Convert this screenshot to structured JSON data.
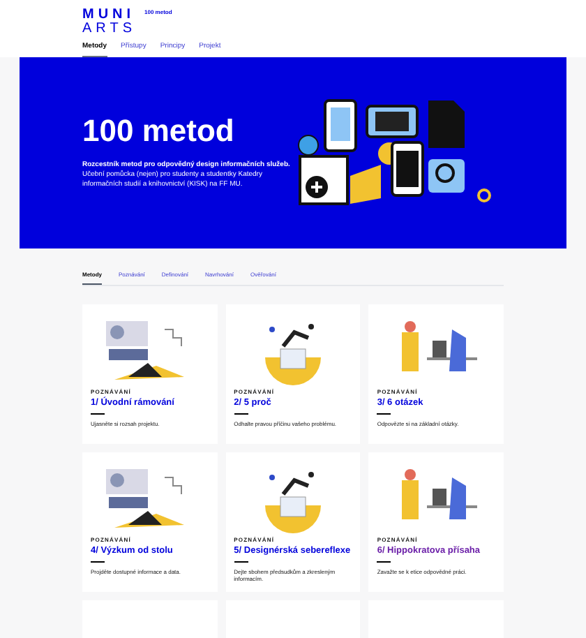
{
  "header": {
    "logo_top": "MUNI",
    "logo_bottom": "ARTS",
    "site_name": "100 metod"
  },
  "nav": [
    {
      "label": "Metody",
      "selected": true
    },
    {
      "label": "Přístupy",
      "selected": false
    },
    {
      "label": "Principy",
      "selected": false
    },
    {
      "label": "Projekt",
      "selected": false
    }
  ],
  "hero": {
    "title": "100 metod",
    "description": "**Rozcestník metod pro odpovědný design informačních služeb.** Učební pomůcka (nejen) pro studenty a studentky Katedry informačních studií a knihovnictví (KISK) na FF MU."
  },
  "filter_tabs": [
    {
      "label": "Metody",
      "selected": true
    },
    {
      "label": "Poznávání",
      "selected": false
    },
    {
      "label": "Definování",
      "selected": false
    },
    {
      "label": "Navrhování",
      "selected": false
    },
    {
      "label": "Ověřování",
      "selected": false
    }
  ],
  "cards": [
    {
      "category": "POZNÁVÁNÍ",
      "title": "1/ Úvodní rámování",
      "description": "Ujasněte si rozsah projektu.",
      "visited": false
    },
    {
      "category": "POZNÁVÁNÍ",
      "title": "2/ 5 proč",
      "description": "Odhalte pravou příčinu vašeho problému.",
      "visited": false
    },
    {
      "category": "POZNÁVÁNÍ",
      "title": "3/ 6 otázek",
      "description": "Odpovězte si na základní otázky.",
      "visited": false
    },
    {
      "category": "POZNÁVÁNÍ",
      "title": "4/ Výzkum od stolu",
      "description": "Projděte dostupné informace a data.",
      "visited": false
    },
    {
      "category": "POZNÁVÁNÍ",
      "title": "5/ Designérská sebereflexe",
      "description": "Dejte sbohem předsudkům a zkresleným informacím.",
      "visited": false
    },
    {
      "category": "POZNÁVÁNÍ",
      "title": "6/ Hippokratova přísaha",
      "description": "Zavažte se k etice odpovědné práci.",
      "visited": true
    }
  ]
}
